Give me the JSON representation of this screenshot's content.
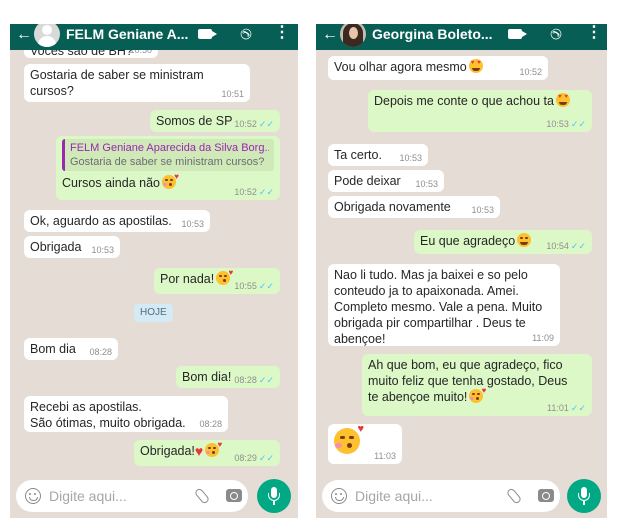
{
  "left_chat": {
    "header": {
      "back_icon": "←",
      "contact_name": "FELM  Geniane A...",
      "icons": [
        "back-arrow-icon",
        "video-call-icon",
        "phone-icon",
        "more-vert-icon"
      ]
    },
    "messages": [
      {
        "dir": "in",
        "text": "Vocês são de BH?",
        "time": "10:50"
      },
      {
        "dir": "in",
        "text": "Gostaria de saber se ministram\ncursos?",
        "time": "10:51"
      },
      {
        "dir": "out",
        "text": "Somos de SP",
        "time": "10:52"
      },
      {
        "dir": "out",
        "quote_name": "FELM  Geniane Aparecida da Silva Borg...",
        "quote_text": "Gostaria de saber se ministram cursos?",
        "text": "Cursos ainda não",
        "time": "10:52"
      },
      {
        "dir": "in",
        "text": "Ok, aguardo as apostilas.",
        "time": "10:53"
      },
      {
        "dir": "in",
        "text": "Obrigada",
        "time": "10:53"
      },
      {
        "dir": "out",
        "text": "Por nada!",
        "time": "10:55"
      },
      {
        "dir": "in",
        "text": "Bom dia",
        "time": "08:28"
      },
      {
        "dir": "out",
        "text": "Bom dia!",
        "time": "08:28"
      },
      {
        "dir": "in",
        "text": "Recebi as apostilas.\nSão ótimas, muito obrigada.",
        "time": "08:28"
      },
      {
        "dir": "out",
        "text": "Obrigada!",
        "time": "08:29"
      }
    ],
    "date_chip": "HOJE",
    "composer_placeholder": "Digite aqui..."
  },
  "right_chat": {
    "header": {
      "back_icon": "←",
      "contact_name": "Georgina Boleto...",
      "icons": [
        "back-arrow-icon",
        "video-call-icon",
        "phone-icon",
        "more-vert-icon"
      ]
    },
    "messages": [
      {
        "dir": "in",
        "text": "Vou olhar agora mesmo",
        "time": "10:52"
      },
      {
        "dir": "out",
        "text": "Depois me conte o que achou ta",
        "time": "10:53"
      },
      {
        "dir": "in",
        "text": "Ta certo.",
        "time": "10:53"
      },
      {
        "dir": "in",
        "text": "Pode deixar",
        "time": "10:53"
      },
      {
        "dir": "in",
        "text": "Obrigada novamente",
        "time": "10:53"
      },
      {
        "dir": "out",
        "text": "Eu que agradeço",
        "time": "10:54"
      },
      {
        "dir": "in",
        "text": "Nao li tudo. Mas ja baixei e so pelo\nconteudo ja to apaixonada. Amei.\nCompleto mesmo. Vale a pena. Muito\nobrigada pir compartilhar . Deus te\nabençoe!",
        "time": "11:09"
      },
      {
        "dir": "out",
        "text": "Ah que bom, eu que agradeço, fico\nmuito feliz que tenha gostado, Deus\nte abençoe muito!",
        "time": "11:01"
      },
      {
        "dir": "in",
        "text": "",
        "time": "11:03"
      }
    ],
    "composer_placeholder": "Digite aqui..."
  },
  "read_ticks": "✓✓",
  "colors": {
    "header": "#075e54",
    "wallpaper": "#e5ddd5",
    "outgoing": "#dcf8c6",
    "incoming": "#ffffff",
    "mic": "#00a884",
    "ticks": "#4fc3f7"
  }
}
